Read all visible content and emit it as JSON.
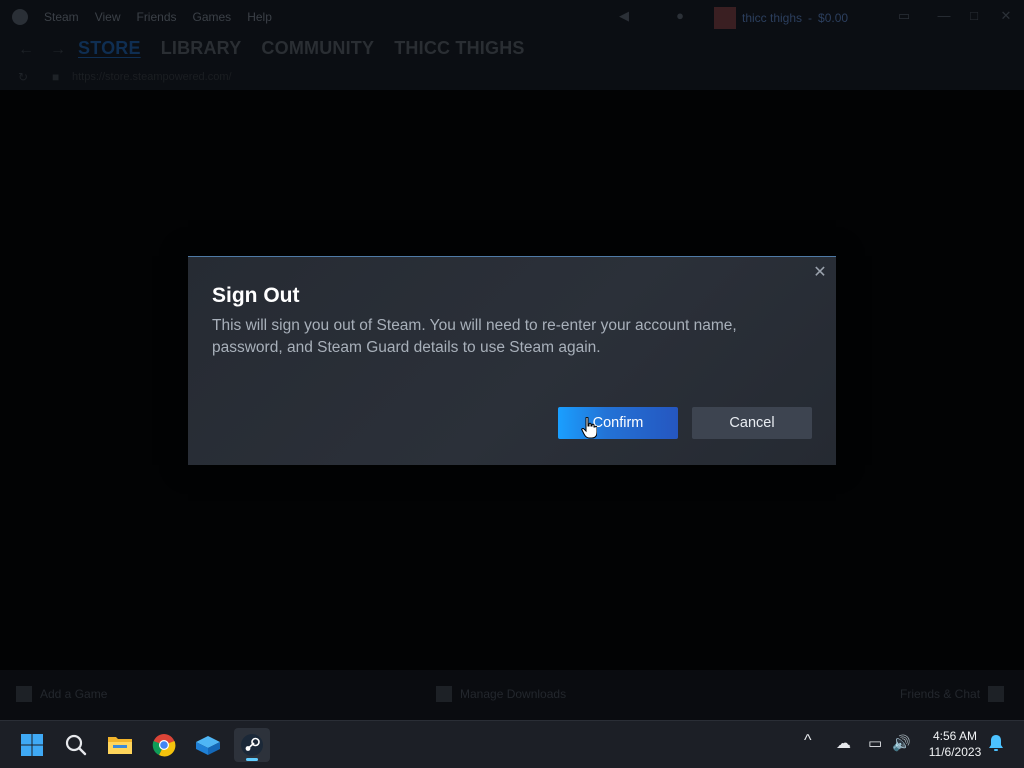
{
  "titlebar": {
    "menu": [
      "Steam",
      "View",
      "Friends",
      "Games",
      "Help"
    ],
    "user_name": "thicc thighs",
    "user_balance": "$0.00"
  },
  "nav": {
    "tabs": [
      "STORE",
      "LIBRARY",
      "COMMUNITY",
      "THICC THIGHS"
    ],
    "active_tab": "STORE",
    "url": "https://store.steampowered.com/"
  },
  "bottombar": {
    "add_game": "Add a Game",
    "manage_downloads": "Manage Downloads",
    "friends_chat": "Friends & Chat"
  },
  "dialog": {
    "title": "Sign Out",
    "message": "This will sign you out of Steam. You will need to re-enter your account name, password, and Steam Guard details to use Steam again.",
    "confirm_label": "Confirm",
    "cancel_label": "Cancel",
    "close_icon": "close-icon"
  },
  "taskbar": {
    "apps": [
      "windows-start-icon",
      "search-icon",
      "file-explorer-icon",
      "chrome-icon",
      "dropbox-icon",
      "steam-icon"
    ],
    "active_app": "steam-icon",
    "tray": [
      "chevron-up-icon",
      "cloud-offline-icon",
      "network-icon",
      "volume-icon",
      "notification-bell-icon"
    ]
  },
  "clock": {
    "time": "4:56 AM",
    "date": "11/6/2023"
  },
  "colors": {
    "accent": "#1a9fff",
    "dialog_bg": "#2a2f38",
    "taskbar_bg": "#1c1f26"
  }
}
